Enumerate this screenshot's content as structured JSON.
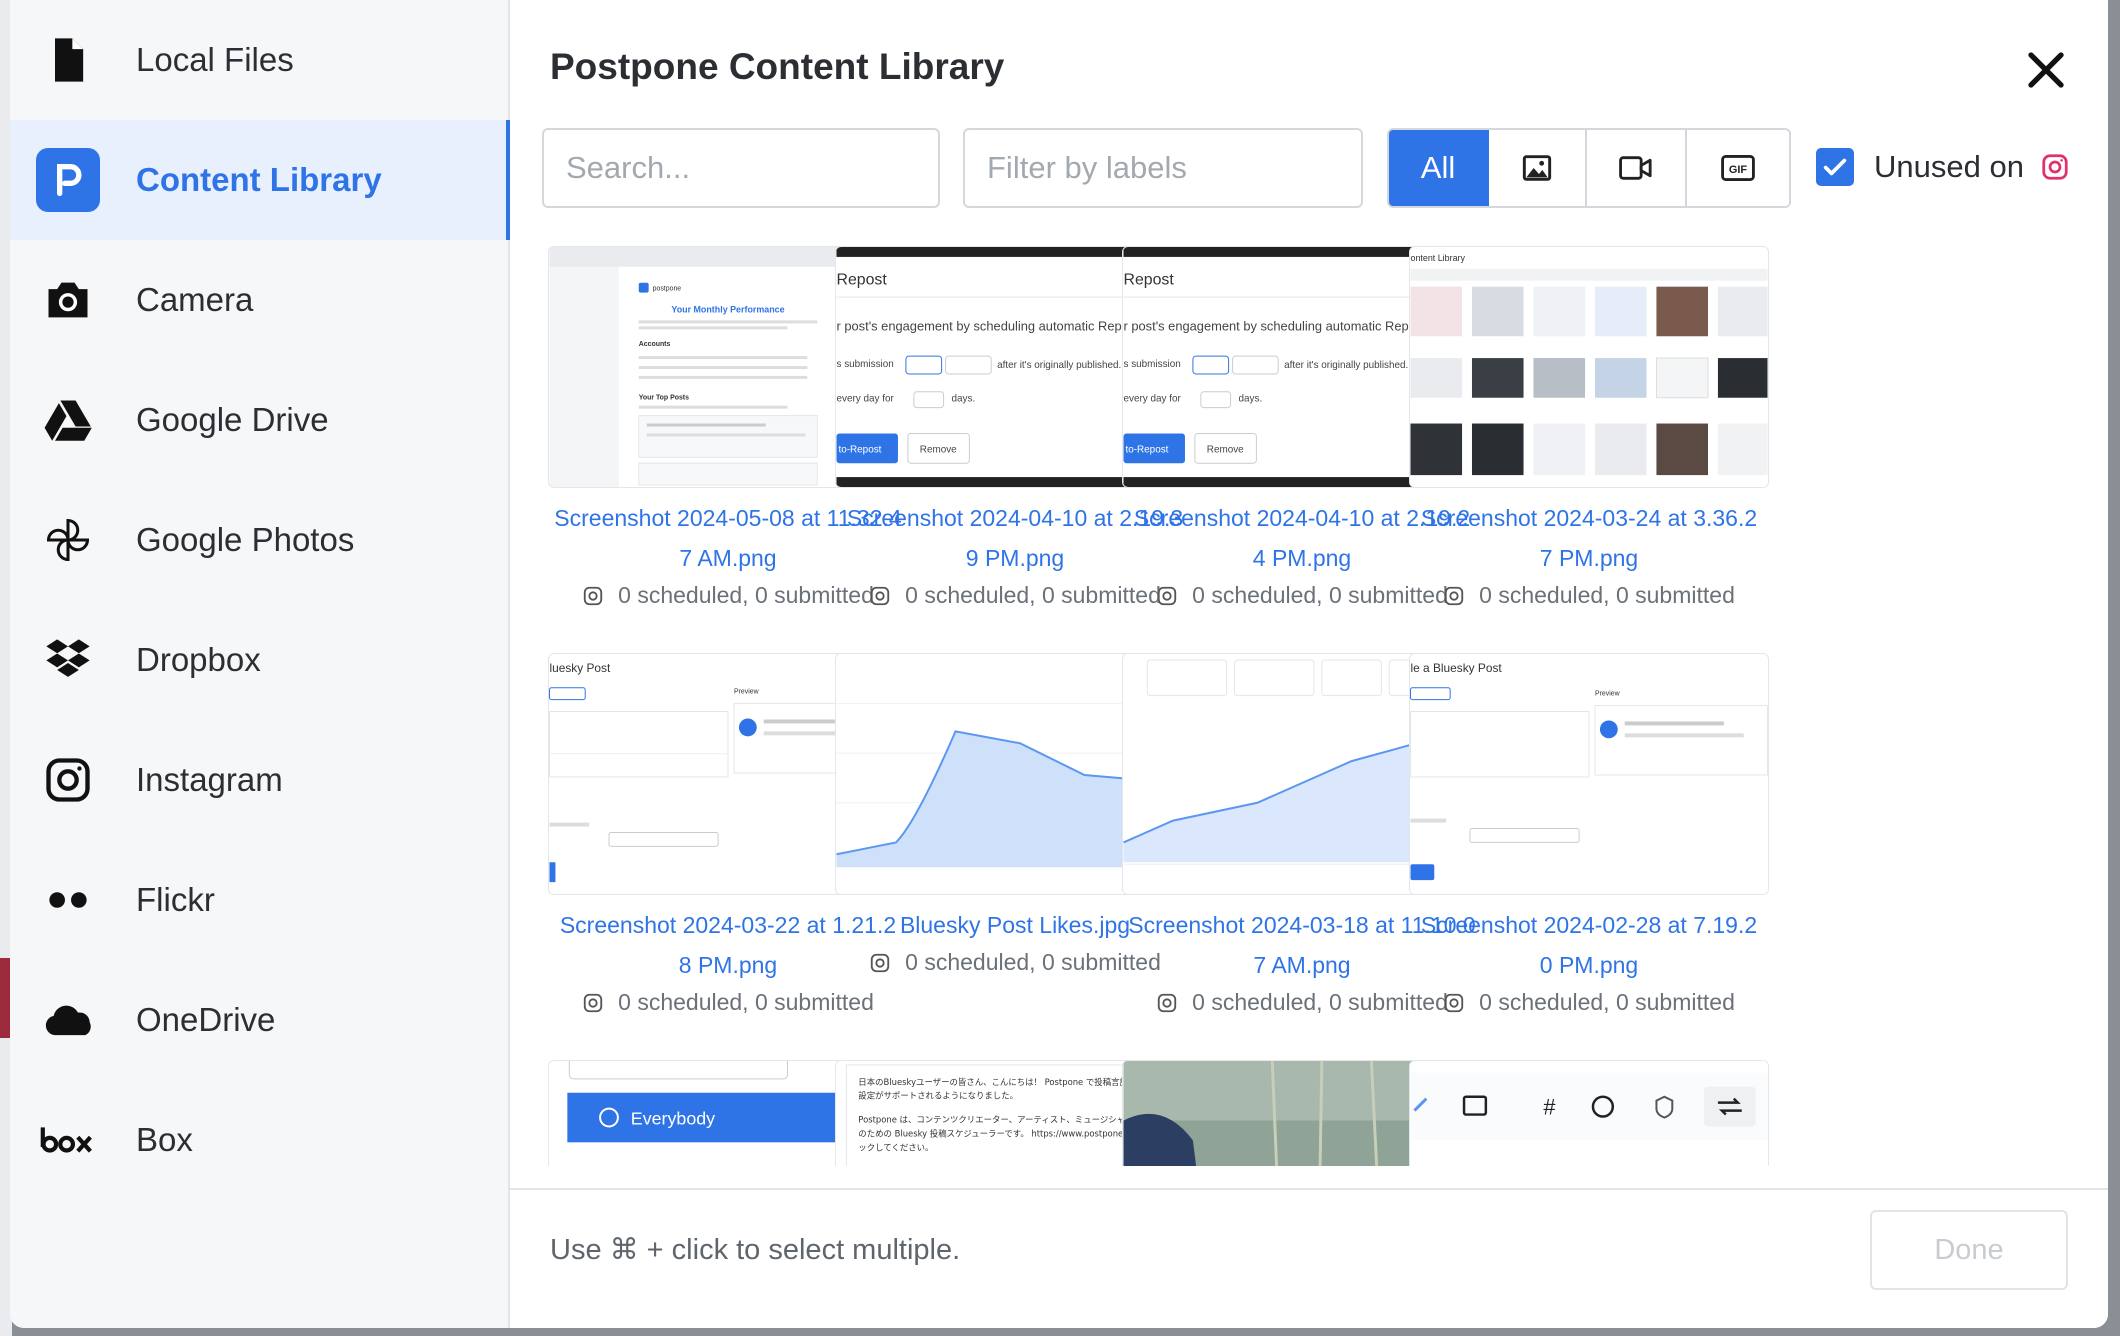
{
  "sidebar": {
    "items": [
      {
        "label": "Local Files",
        "icon": "file-icon"
      },
      {
        "label": "Content Library",
        "icon": "postpone-logo-icon",
        "active": true
      },
      {
        "label": "Camera",
        "icon": "camera-icon"
      },
      {
        "label": "Google Drive",
        "icon": "google-drive-icon"
      },
      {
        "label": "Google Photos",
        "icon": "google-photos-icon"
      },
      {
        "label": "Dropbox",
        "icon": "dropbox-icon"
      },
      {
        "label": "Instagram",
        "icon": "instagram-icon"
      },
      {
        "label": "Flickr",
        "icon": "flickr-icon"
      },
      {
        "label": "OneDrive",
        "icon": "onedrive-icon"
      },
      {
        "label": "Box",
        "icon": "box-icon"
      }
    ]
  },
  "header": {
    "title": "Postpone Content Library"
  },
  "filters": {
    "search_placeholder": "Search...",
    "labels_placeholder": "Filter by labels",
    "type_all": "All",
    "type_buttons": [
      "image-icon",
      "video-icon",
      "gif-icon"
    ],
    "unused_label": "Unused on",
    "unused_checked": true
  },
  "media": [
    {
      "name": "Screenshot 2024-05-08 at 11.32.47 AM.png",
      "line1": "Screenshot 2024-05-08 at 11.32.4",
      "line2": "7 AM.png",
      "status": "0 scheduled, 0 submitted"
    },
    {
      "name": "Screenshot 2024-04-10 at 2.19.39 PM.png",
      "line1": "Screenshot 2024-04-10 at 2.19.3",
      "line2": "9 PM.png",
      "status": "0 scheduled, 0 submitted"
    },
    {
      "name": "Screenshot 2024-04-10 at 2.19.24 PM.png",
      "line1": "Screenshot 2024-04-10 at 2.19.2",
      "line2": "4 PM.png",
      "status": "0 scheduled, 0 submitted"
    },
    {
      "name": "Screenshot 2024-03-24 at 3.36.27 PM.png",
      "line1": "Screenshot 2024-03-24 at 3.36.2",
      "line2": "7 PM.png",
      "status": "0 scheduled, 0 submitted"
    },
    {
      "name": "Screenshot 2024-03-22 at 1.21.28 PM.png",
      "line1": "Screenshot 2024-03-22 at 1.21.2",
      "line2": "8 PM.png",
      "status": "0 scheduled, 0 submitted"
    },
    {
      "name": "Bluesky Post Likes.jpg",
      "line1": "Bluesky Post Likes.jpg",
      "line2": "",
      "status": "0 scheduled, 0 submitted"
    },
    {
      "name": "Screenshot 2024-03-18 at 11.10.07 AM.png",
      "line1": "Screenshot 2024-03-18 at 11.10.0",
      "line2": "7 AM.png",
      "status": "0 scheduled, 0 submitted"
    },
    {
      "name": "Screenshot 2024-02-28 at 7.19.20 PM.png",
      "line1": "Screenshot 2024-02-28 at 7.19.2",
      "line2": "0 PM.png",
      "status": "0 scheduled, 0 submitted"
    }
  ],
  "thumb_text": {
    "perf_brand": "postpone",
    "perf_title": "Your Monthly Performance",
    "perf_accounts": "Accounts",
    "perf_top": "Your Top Posts",
    "repost_title": "Repost",
    "repost_line": "r post's engagement by scheduling automatic Reposts.",
    "repost_submission": "s submission",
    "repost_after": "after it's originally published.",
    "repost_every": "every day for",
    "repost_days": "days.",
    "repost_button": "to-Repost",
    "repost_remove": "Remove",
    "library_title": "ontent Library",
    "bluesky_title": "luesky Post",
    "bluesky_title2": "le a Bluesky Post",
    "preview": "Preview",
    "everybody": "Everybody",
    "jp_line1": "日本のBlueskyユーザーの皆さん、こんにちは！ Postpone で投稿言語の日本語",
    "jp_line2": "設定がサポートされるようになりました。",
    "jp_line3": "Postpone は、コンテンツクリエーター、アーティスト、ミュージシャンなど",
    "jp_line4": "のための Bluesky 投稿スケジューラーです。 https://www.postpone.app でチェ",
    "jp_line5": "ックしてください。"
  },
  "footer": {
    "hint": "Use ⌘ + click to select multiple.",
    "done_label": "Done"
  },
  "colors": {
    "accent": "#2f74e6",
    "instagram": "#e1306c"
  }
}
